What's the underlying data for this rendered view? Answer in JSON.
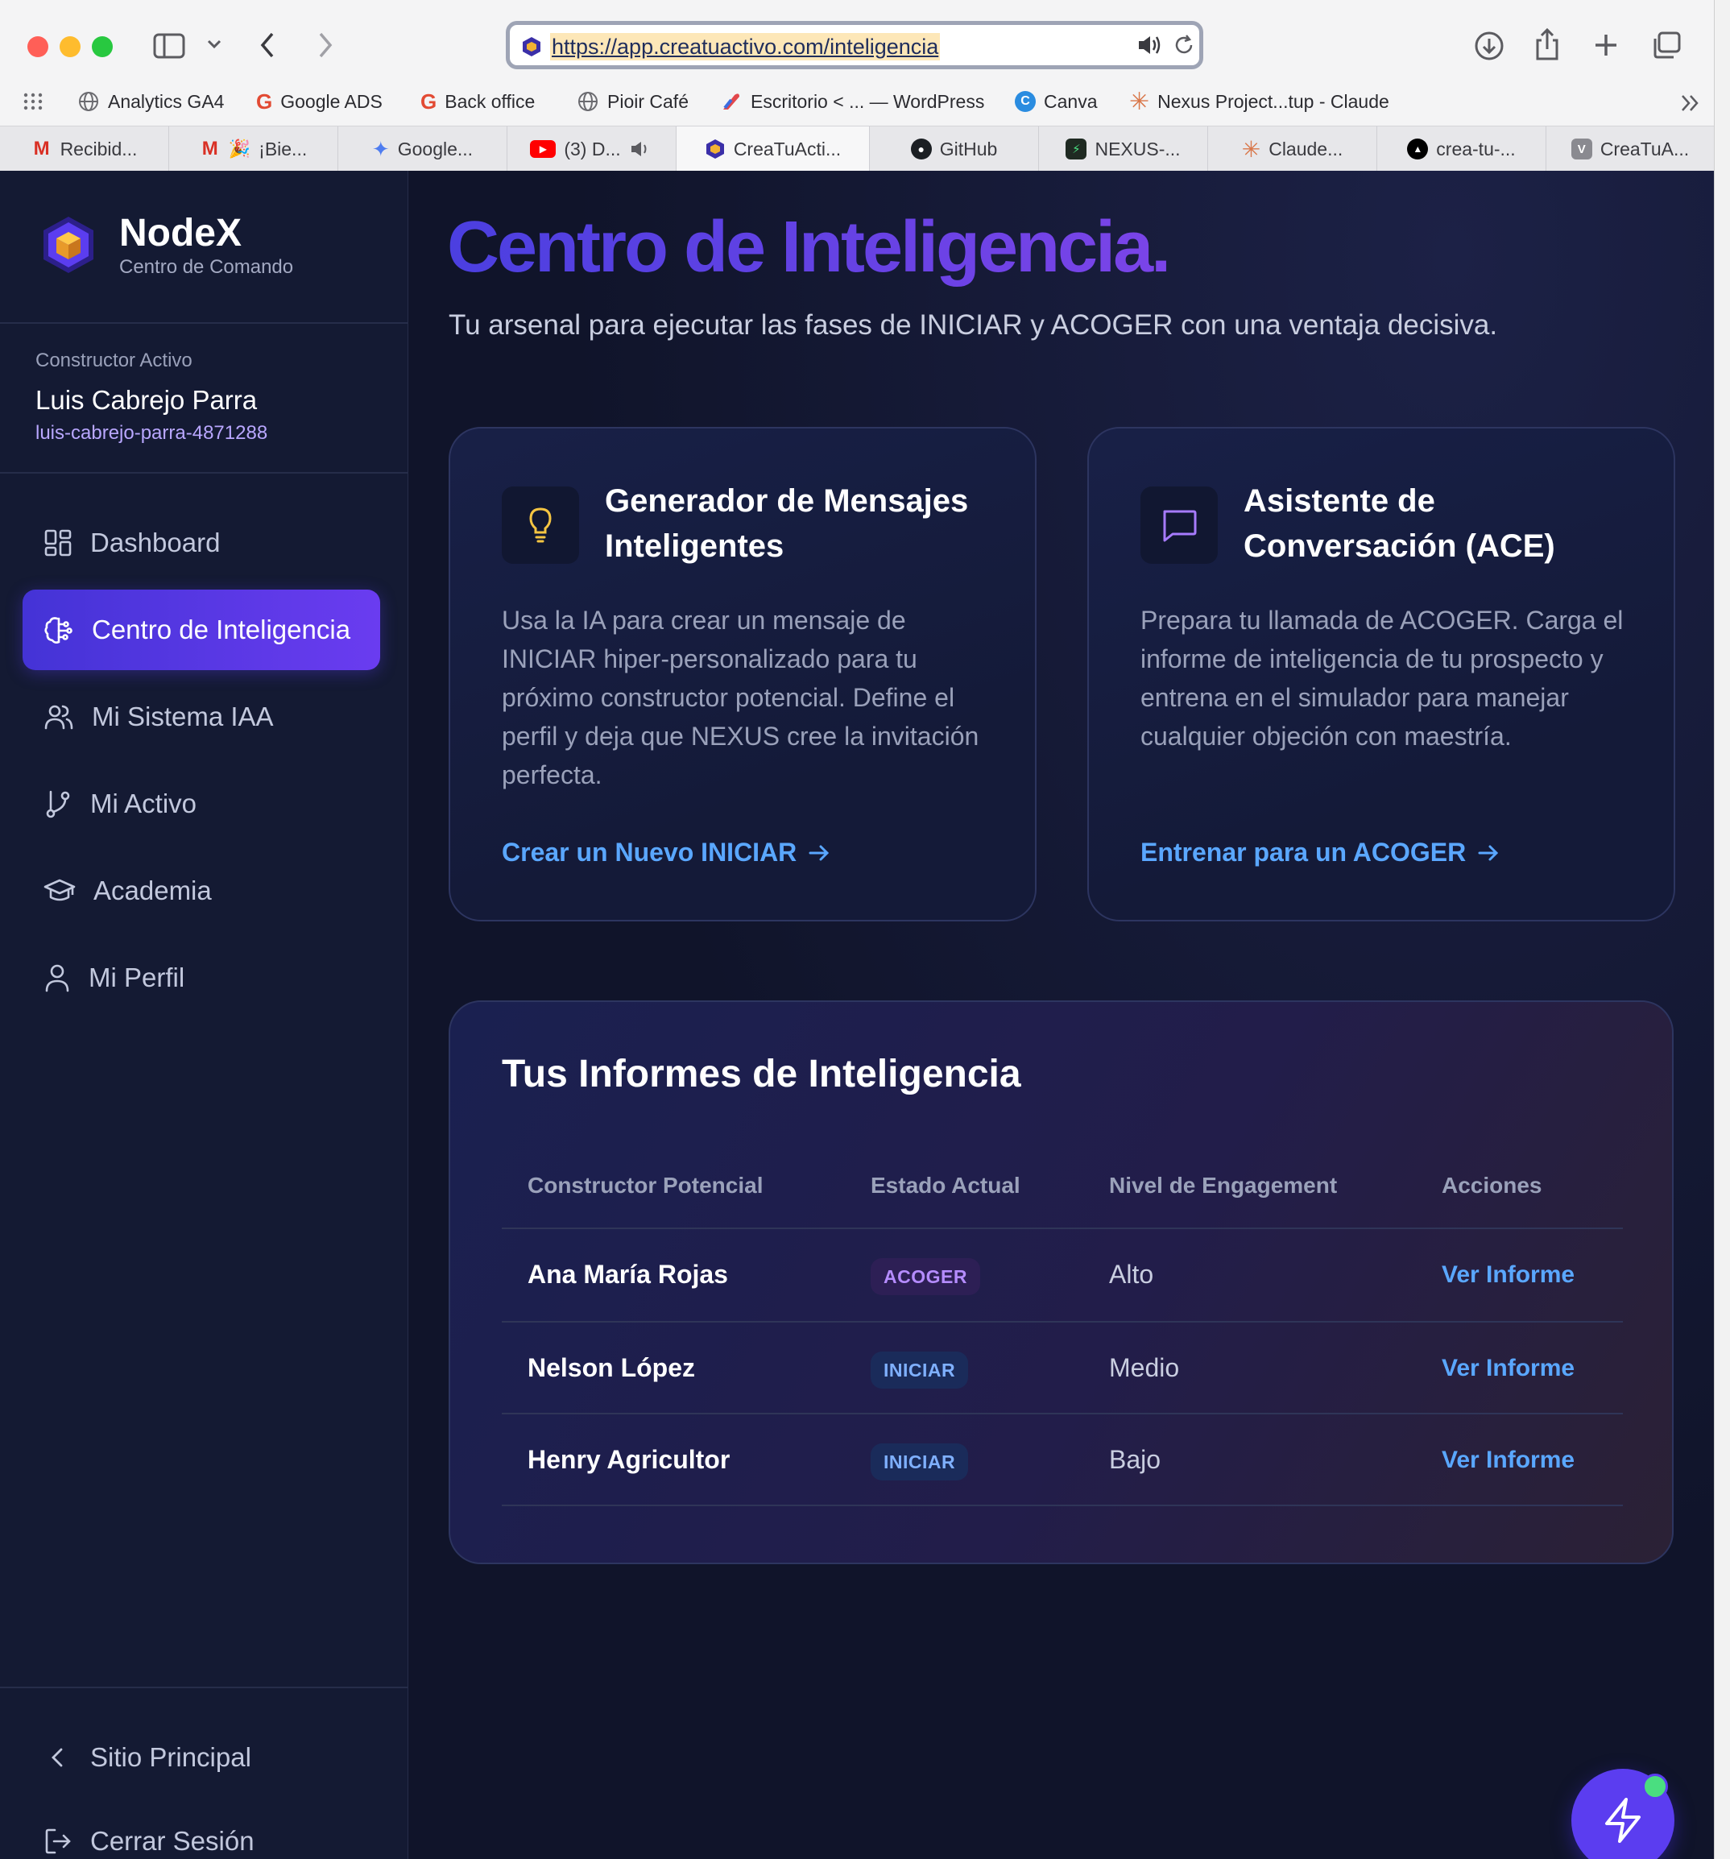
{
  "browser": {
    "url": "https://app.creatuactivo.com/inteligencia",
    "bookmarks": [
      {
        "label": "Analytics GA4"
      },
      {
        "label": "Google ADS"
      },
      {
        "label": "Back office"
      },
      {
        "label": "Pioir Café"
      },
      {
        "label": "Escritorio < ... — WordPress"
      },
      {
        "label": "Canva"
      },
      {
        "label": "Nexus Project...tup - Claude"
      }
    ],
    "tabs": [
      {
        "label": "Recibid..."
      },
      {
        "label": "¡Bie..."
      },
      {
        "label": "Google..."
      },
      {
        "label": "(3) D..."
      },
      {
        "label": "CreaTuActi..."
      },
      {
        "label": "GitHub"
      },
      {
        "label": "NEXUS-..."
      },
      {
        "label": "Claude..."
      },
      {
        "label": "crea-tu-..."
      },
      {
        "label": "CreaTuA..."
      }
    ]
  },
  "sidebar": {
    "brand": {
      "name": "NodeX",
      "subtitle": "Centro de Comando"
    },
    "user": {
      "label": "Constructor Activo",
      "name": "Luis Cabrejo Parra",
      "id": "luis-cabrejo-parra-4871288"
    },
    "nav": [
      {
        "label": "Dashboard",
        "icon": "dashboard-icon"
      },
      {
        "label": "Centro de Inteligencia",
        "icon": "brain-icon",
        "active": true
      },
      {
        "label": "Mi Sistema IAA",
        "icon": "users-icon"
      },
      {
        "label": "Mi Activo",
        "icon": "git-branch-icon"
      },
      {
        "label": "Academia",
        "icon": "graduation-cap-icon"
      },
      {
        "label": "Mi Perfil",
        "icon": "user-icon"
      }
    ],
    "footer": [
      {
        "label": "Sitio Principal",
        "icon": "chevron-left-icon"
      },
      {
        "label": "Cerrar Sesión",
        "icon": "logout-icon"
      }
    ]
  },
  "main": {
    "title": "Centro de Inteligencia.",
    "subtitle": "Tu arsenal para ejecutar las fases de INICIAR y ACOGER con una ventaja decisiva.",
    "cards": [
      {
        "title_line1": "Generador de Mensajes",
        "title_line2": "Inteligentes",
        "desc_lines": [
          "Usa la IA para crear un mensaje de",
          "INICIAR hiper-personalizado para tu",
          "próximo constructor potencial. Define el",
          "perfil y deja que NEXUS cree la invitación",
          "perfecta."
        ],
        "link": "Crear un Nuevo INICIAR",
        "icon": "lightbulb-icon"
      },
      {
        "title_line1": "Asistente de",
        "title_line2": "Conversación (ACE)",
        "desc_lines": [
          "Prepara tu llamada de ACOGER. Carga el",
          "informe de inteligencia de tu prospecto y",
          "entrena en el simulador para manejar",
          "cualquier objeción con maestría."
        ],
        "link": "Entrenar para un ACOGER",
        "icon": "chat-icon"
      }
    ],
    "reports": {
      "title": "Tus Informes de Inteligencia",
      "headers": [
        "Constructor Potencial",
        "Estado Actual",
        "Nivel de Engagement",
        "Acciones"
      ],
      "rows": [
        {
          "name": "Ana María Rojas",
          "status": "ACOGER",
          "engagement": "Alto",
          "action": "Ver Informe"
        },
        {
          "name": "Nelson López",
          "status": "INICIAR",
          "engagement": "Medio",
          "action": "Ver Informe"
        },
        {
          "name": "Henry Agricultor",
          "status": "INICIAR",
          "engagement": "Bajo",
          "action": "Ver Informe"
        }
      ]
    }
  },
  "colors": {
    "accent": "#5b3df0",
    "link": "#5aa7ff",
    "background": "#0f1328",
    "sidebar": "#141a33"
  },
  "fab": {
    "icon": "lightning-icon"
  }
}
